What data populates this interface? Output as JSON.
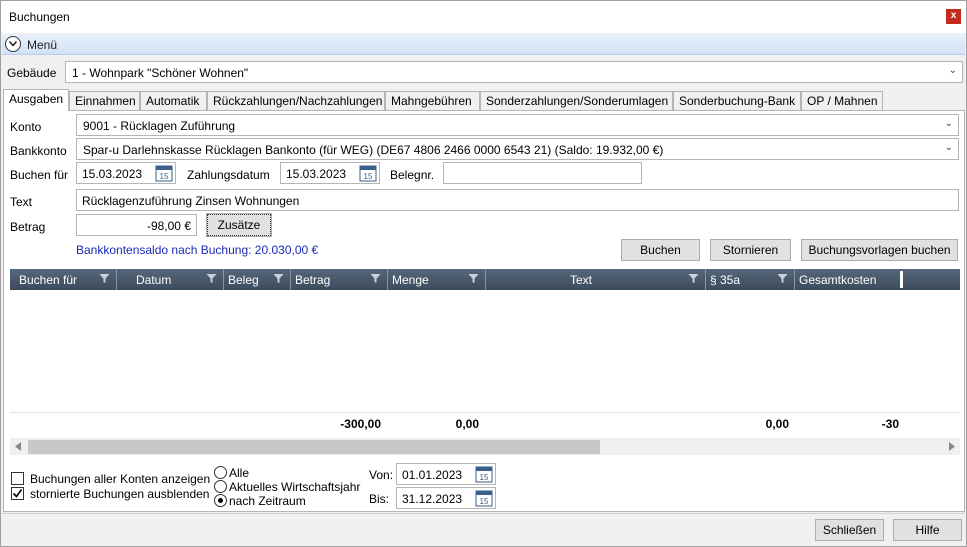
{
  "window": {
    "title": "Buchungen",
    "close": "x"
  },
  "menu": {
    "label": "Menü"
  },
  "gebaeude": {
    "label": "Gebäude",
    "value": "1 - Wohnpark \"Schöner Wohnen\""
  },
  "tabs": [
    "Ausgaben",
    "Einnahmen",
    "Automatik",
    "Rückzahlungen/Nachzahlungen",
    "Mahngebühren",
    "Sonderzahlungen/Sonderumlagen",
    "Sonderbuchung-Bank",
    "OP / Mahnen"
  ],
  "form": {
    "konto_label": "Konto",
    "konto_value": "9001 - Rücklagen Zuführung",
    "bankkonto_label": "Bankkonto",
    "bankkonto_value": "Spar-u Darlehnskasse Rücklagen Bankonto  (für WEG) (DE67 4806 2466 0000 6543 21) (Saldo: 19.932,00 €)",
    "buchen_fuer_label": "Buchen für",
    "buchen_fuer_value": "15.03.2023",
    "zahlungsdatum_label": "Zahlungsdatum",
    "zahlungsdatum_value": "15.03.2023",
    "belegnr_label": "Belegnr.",
    "belegnr_value": "",
    "text_label": "Text",
    "text_value": "Rücklagenzuführung Zinsen Wohnungen",
    "betrag_label": "Betrag",
    "betrag_value": "-98,00 €",
    "zusaetze_label": "Zusätze",
    "saldo_text": "Bankkontensaldo nach Buchung: 20.030,00 €"
  },
  "actions": {
    "buchen": "Buchen",
    "stornieren": "Stornieren",
    "vorlagen": "Buchungsvorlagen buchen"
  },
  "grid": {
    "columns": [
      "Buchen für",
      "Datum",
      "Beleg",
      "Betrag",
      "Menge",
      "Text",
      "§ 35a",
      "Gesamtkosten"
    ],
    "sums": {
      "betrag": "-300,00",
      "menge": "0,00",
      "s35a": "0,00",
      "gesamt": "-30"
    }
  },
  "filters": {
    "alle_konten": "Buchungen aller Konten anzeigen",
    "alle_konten_checked": false,
    "stornierte": "stornierte Buchungen ausblenden",
    "stornierte_checked": true,
    "radio_alle": "Alle",
    "radio_wirtschaftsjahr": "Aktuelles Wirtschaftsjahr",
    "radio_zeitraum": "nach Zeitraum",
    "selected_radio": "nach Zeitraum",
    "von_label": "Von:",
    "von_value": "01.01.2023",
    "bis_label": "Bis:",
    "bis_value": "31.12.2023"
  },
  "footer": {
    "schliessen": "Schließen",
    "hilfe": "Hilfe"
  },
  "colors": {
    "accent": "#1a2bb8",
    "grid_header": "#3c4b5c",
    "close": "#c42b1c"
  },
  "icons": [
    "close-icon",
    "chevron-down-icon",
    "calendar-icon",
    "filter-icon"
  ]
}
